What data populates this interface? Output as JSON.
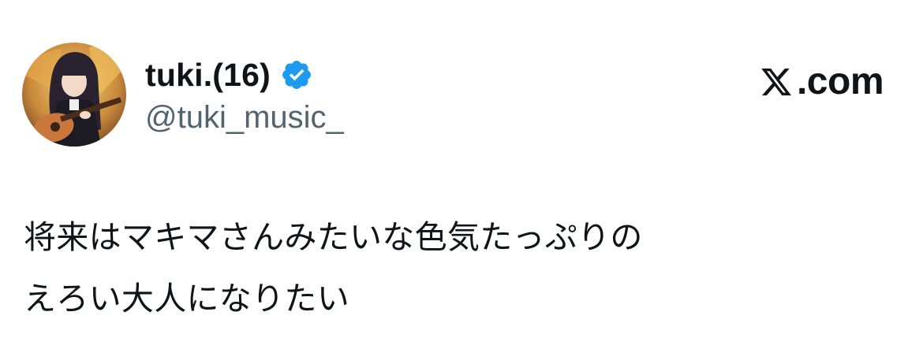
{
  "author": {
    "display_name": "tuki.(16)",
    "handle": "@tuki_music_",
    "verified": true,
    "avatar_icon": "avatar-photo-girl-with-guitar",
    "verified_icon": "verified-badge-icon"
  },
  "brand": {
    "logo_icon": "x-logo-icon",
    "text": ".com"
  },
  "tweet": {
    "lines": [
      "将来はマキマさんみたいな色気たっぷりの",
      "えろい大人になりたい"
    ]
  },
  "colors": {
    "text": "#0f1419",
    "handle": "#536471",
    "verified": "#1d9bf0",
    "background": "#ffffff"
  }
}
